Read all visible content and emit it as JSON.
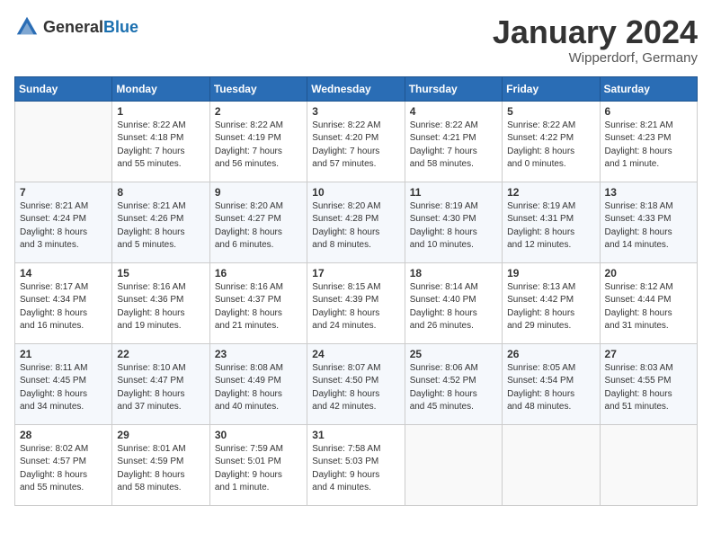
{
  "header": {
    "logo_general": "General",
    "logo_blue": "Blue",
    "month": "January 2024",
    "location": "Wipperdorf, Germany"
  },
  "weekdays": [
    "Sunday",
    "Monday",
    "Tuesday",
    "Wednesday",
    "Thursday",
    "Friday",
    "Saturday"
  ],
  "weeks": [
    [
      {
        "day": "",
        "info": ""
      },
      {
        "day": "1",
        "info": "Sunrise: 8:22 AM\nSunset: 4:18 PM\nDaylight: 7 hours\nand 55 minutes."
      },
      {
        "day": "2",
        "info": "Sunrise: 8:22 AM\nSunset: 4:19 PM\nDaylight: 7 hours\nand 56 minutes."
      },
      {
        "day": "3",
        "info": "Sunrise: 8:22 AM\nSunset: 4:20 PM\nDaylight: 7 hours\nand 57 minutes."
      },
      {
        "day": "4",
        "info": "Sunrise: 8:22 AM\nSunset: 4:21 PM\nDaylight: 7 hours\nand 58 minutes."
      },
      {
        "day": "5",
        "info": "Sunrise: 8:22 AM\nSunset: 4:22 PM\nDaylight: 8 hours\nand 0 minutes."
      },
      {
        "day": "6",
        "info": "Sunrise: 8:21 AM\nSunset: 4:23 PM\nDaylight: 8 hours\nand 1 minute."
      }
    ],
    [
      {
        "day": "7",
        "info": "Sunrise: 8:21 AM\nSunset: 4:24 PM\nDaylight: 8 hours\nand 3 minutes."
      },
      {
        "day": "8",
        "info": "Sunrise: 8:21 AM\nSunset: 4:26 PM\nDaylight: 8 hours\nand 5 minutes."
      },
      {
        "day": "9",
        "info": "Sunrise: 8:20 AM\nSunset: 4:27 PM\nDaylight: 8 hours\nand 6 minutes."
      },
      {
        "day": "10",
        "info": "Sunrise: 8:20 AM\nSunset: 4:28 PM\nDaylight: 8 hours\nand 8 minutes."
      },
      {
        "day": "11",
        "info": "Sunrise: 8:19 AM\nSunset: 4:30 PM\nDaylight: 8 hours\nand 10 minutes."
      },
      {
        "day": "12",
        "info": "Sunrise: 8:19 AM\nSunset: 4:31 PM\nDaylight: 8 hours\nand 12 minutes."
      },
      {
        "day": "13",
        "info": "Sunrise: 8:18 AM\nSunset: 4:33 PM\nDaylight: 8 hours\nand 14 minutes."
      }
    ],
    [
      {
        "day": "14",
        "info": "Sunrise: 8:17 AM\nSunset: 4:34 PM\nDaylight: 8 hours\nand 16 minutes."
      },
      {
        "day": "15",
        "info": "Sunrise: 8:16 AM\nSunset: 4:36 PM\nDaylight: 8 hours\nand 19 minutes."
      },
      {
        "day": "16",
        "info": "Sunrise: 8:16 AM\nSunset: 4:37 PM\nDaylight: 8 hours\nand 21 minutes."
      },
      {
        "day": "17",
        "info": "Sunrise: 8:15 AM\nSunset: 4:39 PM\nDaylight: 8 hours\nand 24 minutes."
      },
      {
        "day": "18",
        "info": "Sunrise: 8:14 AM\nSunset: 4:40 PM\nDaylight: 8 hours\nand 26 minutes."
      },
      {
        "day": "19",
        "info": "Sunrise: 8:13 AM\nSunset: 4:42 PM\nDaylight: 8 hours\nand 29 minutes."
      },
      {
        "day": "20",
        "info": "Sunrise: 8:12 AM\nSunset: 4:44 PM\nDaylight: 8 hours\nand 31 minutes."
      }
    ],
    [
      {
        "day": "21",
        "info": "Sunrise: 8:11 AM\nSunset: 4:45 PM\nDaylight: 8 hours\nand 34 minutes."
      },
      {
        "day": "22",
        "info": "Sunrise: 8:10 AM\nSunset: 4:47 PM\nDaylight: 8 hours\nand 37 minutes."
      },
      {
        "day": "23",
        "info": "Sunrise: 8:08 AM\nSunset: 4:49 PM\nDaylight: 8 hours\nand 40 minutes."
      },
      {
        "day": "24",
        "info": "Sunrise: 8:07 AM\nSunset: 4:50 PM\nDaylight: 8 hours\nand 42 minutes."
      },
      {
        "day": "25",
        "info": "Sunrise: 8:06 AM\nSunset: 4:52 PM\nDaylight: 8 hours\nand 45 minutes."
      },
      {
        "day": "26",
        "info": "Sunrise: 8:05 AM\nSunset: 4:54 PM\nDaylight: 8 hours\nand 48 minutes."
      },
      {
        "day": "27",
        "info": "Sunrise: 8:03 AM\nSunset: 4:55 PM\nDaylight: 8 hours\nand 51 minutes."
      }
    ],
    [
      {
        "day": "28",
        "info": "Sunrise: 8:02 AM\nSunset: 4:57 PM\nDaylight: 8 hours\nand 55 minutes."
      },
      {
        "day": "29",
        "info": "Sunrise: 8:01 AM\nSunset: 4:59 PM\nDaylight: 8 hours\nand 58 minutes."
      },
      {
        "day": "30",
        "info": "Sunrise: 7:59 AM\nSunset: 5:01 PM\nDaylight: 9 hours\nand 1 minute."
      },
      {
        "day": "31",
        "info": "Sunrise: 7:58 AM\nSunset: 5:03 PM\nDaylight: 9 hours\nand 4 minutes."
      },
      {
        "day": "",
        "info": ""
      },
      {
        "day": "",
        "info": ""
      },
      {
        "day": "",
        "info": ""
      }
    ]
  ]
}
